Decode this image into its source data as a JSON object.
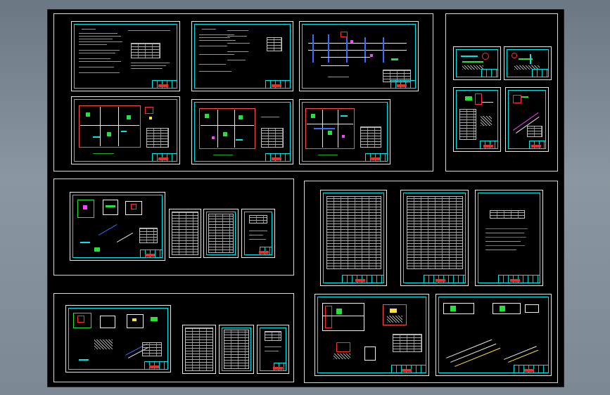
{
  "app": {
    "view": "cad-drawing-thumbnail"
  },
  "colors": {
    "background": "#000000",
    "sheet_border": "#00e5e5",
    "frame": "#d8d8d8",
    "accent_red": "#e8302a",
    "accent_green": "#27e03a",
    "accent_magenta": "#ff40ff"
  },
  "groups": [
    {
      "id": "top-left",
      "sheet_count": 6
    },
    {
      "id": "top-right",
      "sheet_count": 4
    },
    {
      "id": "middle-left",
      "sheet_count": 4
    },
    {
      "id": "right",
      "sheet_count": 5
    },
    {
      "id": "bottom-left",
      "sheet_count": 4
    }
  ]
}
